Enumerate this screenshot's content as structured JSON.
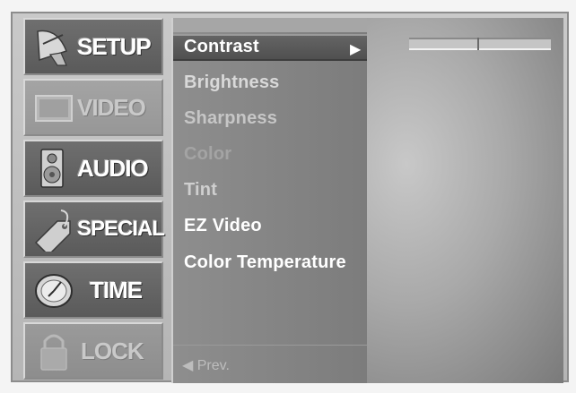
{
  "categories": [
    {
      "label": "SETUP",
      "icon": "satellite-dish-icon",
      "state": "normal"
    },
    {
      "label": "VIDEO",
      "icon": "tv-screen-icon",
      "state": "active"
    },
    {
      "label": "AUDIO",
      "icon": "speaker-icon",
      "state": "normal"
    },
    {
      "label": "SPECIAL",
      "icon": "tag-icon",
      "state": "normal"
    },
    {
      "label": "TIME",
      "icon": "clock-icon",
      "state": "normal"
    },
    {
      "label": "LOCK",
      "icon": "padlock-icon",
      "state": "dim"
    }
  ],
  "submenu": {
    "items": [
      {
        "label": "Contrast",
        "selected": true
      },
      {
        "label": "Brightness"
      },
      {
        "label": "Sharpness"
      },
      {
        "label": "Color"
      },
      {
        "label": "Tint"
      },
      {
        "label": "EZ Video"
      },
      {
        "label": "Color Temperature"
      }
    ],
    "selected_arrow": "▶",
    "prev_label": "◀ Prev."
  },
  "colors": {
    "menu_bg": "#7c7c7c",
    "selected_bg": "#505050",
    "text": "#ffffff"
  }
}
